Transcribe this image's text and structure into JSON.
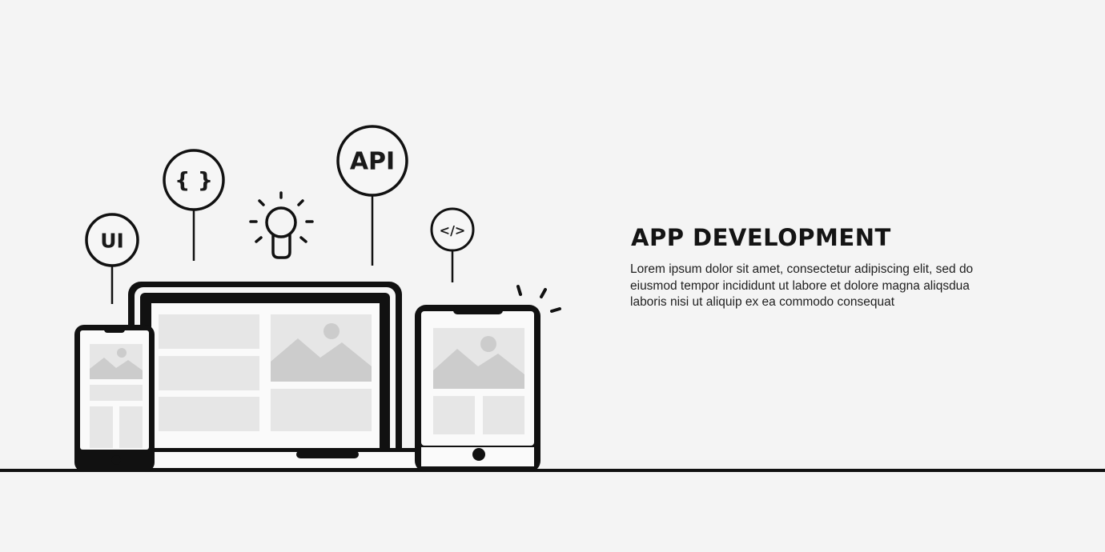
{
  "banner": {
    "title": "APP DEVELOPMENT",
    "description_lines": [
      "Lorem ipsum dolor sit amet, consectetur adipiscing elit, sed do",
      "eiusmod tempor incididunt ut labore et dolore magna aliqsdua",
      "laboris nisi ut aliquip ex ea commodo consequat"
    ]
  },
  "bubbles": {
    "ui": "UI",
    "braces": "{ }",
    "api": "API",
    "code": "</>"
  },
  "icons": [
    "lightbulb-icon",
    "phone-icon",
    "laptop-icon",
    "tablet-icon",
    "image-placeholder-icon"
  ],
  "colors": {
    "background": "#f4f4f4",
    "outline": "#111111",
    "placeholder": "#e6e6e6",
    "image_fill": "#cccccc"
  }
}
